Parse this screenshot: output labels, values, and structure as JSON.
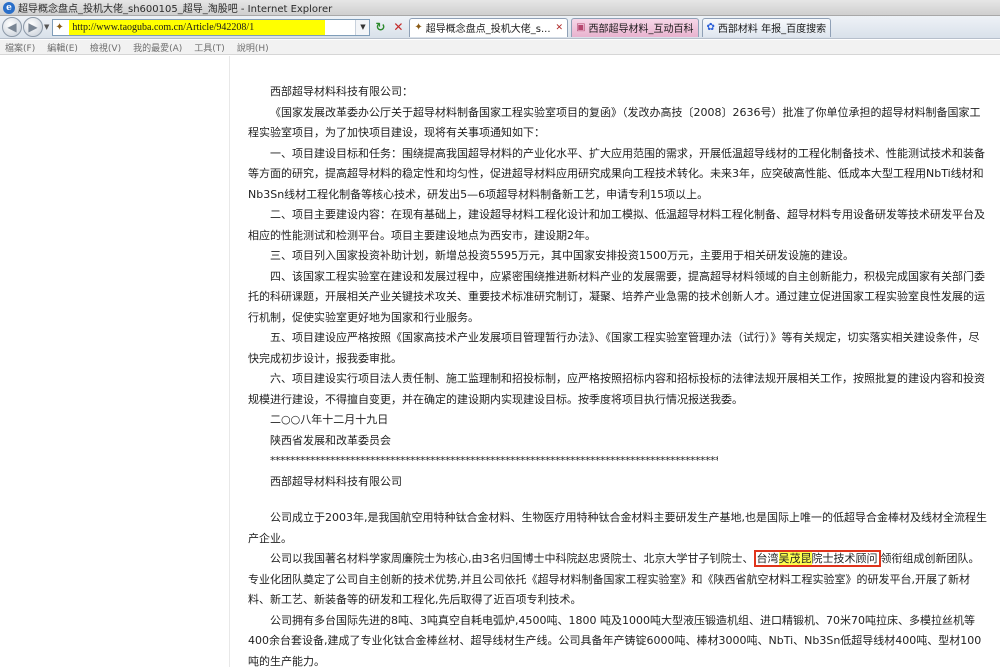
{
  "window": {
    "title": "超导概念盘点_投机大佬_sh600105_超导_淘股吧 - Internet Explorer"
  },
  "nav": {
    "url": "http://www.taoguba.com.cn/Article/942208/1"
  },
  "tabs": [
    {
      "label": "超导概念盘点_投机大佬_s...",
      "active": true,
      "icon": "site-icon"
    },
    {
      "label": "西部超导材料_互动百科",
      "active": false,
      "icon": "wiki-icon"
    },
    {
      "label": "西部材料 年报_百度搜索",
      "active": false,
      "icon": "baidu-paw-icon"
    }
  ],
  "menu": [
    "檔案(F)",
    "編輯(E)",
    "檢視(V)",
    "我的最愛(A)",
    "工具(T)",
    "說明(H)"
  ],
  "article": {
    "salutation": "西部超导材料科技有限公司：",
    "p1": "《国家发展改革委办公厅关于超导材料制备国家工程实验室项目的复函》（发改办高技〔2008〕2636号）批准了你单位承担的超导材料制备国家工程实验室项目，为了加快项目建设，现将有关事项通知如下：",
    "p2": "一、项目建设目标和任务：围绕提高我国超导材料的产业化水平、扩大应用范围的需求，开展低温超导线材的工程化制备技术、性能测试技术和装备等方面的研究，提高超导材料的稳定性和均匀性，促进超导材料应用研究成果向工程技术转化。未来3年，应突破高性能、低成本大型工程用NbTi线材和Nb3Sn线材工程化制备等核心技术，研发出5—6项超导材料制备新工艺，申请专利15项以上。",
    "p3": "二、项目主要建设内容：在现有基础上，建设超导材料工程化设计和加工模拟、低温超导材料工程化制备、超导材料专用设备研发等技术研发平台及相应的性能测试和检测平台。项目主要建设地点为西安市，建设期2年。",
    "p4": "三、项目列入国家投资补助计划，新增总投资5595万元，其中国家安排投资1500万元，主要用于相关研发设施的建设。",
    "p5": "四、该国家工程实验室在建设和发展过程中，应紧密围绕推进新材料产业的发展需要，提高超导材料领域的自主创新能力，积极完成国家有关部门委托的科研课题，开展相关产业关键技术攻关、重要技术标准研究制订，凝聚、培养产业急需的技术创新人才。通过建立促进国家工程实验室良性发展的运行机制，促使实验室更好地为国家和行业服务。",
    "p6": "五、项目建设应严格按照《国家高技术产业发展项目管理暂行办法》、《国家工程实验室管理办法（试行）》等有关规定，切实落实相关建设条件，尽快完成初步设计，报我委审批。",
    "p7": "六、项目建设实行项目法人责任制、施工监理制和招投标制，应严格按照招标内容和招标投标的法律法规开展相关工作，按照批复的建设内容和投资规模进行建设，不得擅自变更，并在确定的建设期内实现建设目标。按季度将项目执行情况报送我委。",
    "date": "二○○八年十二月十九日",
    "issuer": "陕西省发展和改革委员会",
    "stars": "*****************************************************************************************************************",
    "company_title": "西部超导材料科技有限公司",
    "c1": "公司成立于2003年,是我国航空用特种钛合金材料、生物医疗用特种钛合金材料主要研发生产基地,也是国际上唯一的低超导合金棒材及线材全流程生产企业。",
    "c2_before": "公司以我国著名材料学家周廉院士为核心,由3名归国博士中科院赵忠贤院士、北京大学甘子钊院士、",
    "c2_hl_pre": "台湾",
    "c2_hl_yellow": "吴茂昆",
    "c2_hl_post": "院士技术顾问",
    "c2_after": "领衔组成创新团队。专业化团队奠定了公司自主创新的技术优势,并且公司依托《超导材料制备国家工程实验室》和《陕西省航空材料工程实验室》的研发平台,开展了新材料、新工艺、新装备等的研发和工程化,先后取得了近百项专利技术。",
    "c3": "公司拥有多台国际先进的8吨、3吨真空自耗电弧炉,4500吨、1800 吨及1000吨大型液压锻造机组、进口精锻机、70米70吨拉床、多模拉丝机等400余台套设备,建成了专业化钛合金棒丝材、超导线材生产线。公司具备年产铸锭6000吨、棒材3000吨、NbTi、Nb3Sn低超导线材400吨、型材100吨的生产能力。"
  }
}
